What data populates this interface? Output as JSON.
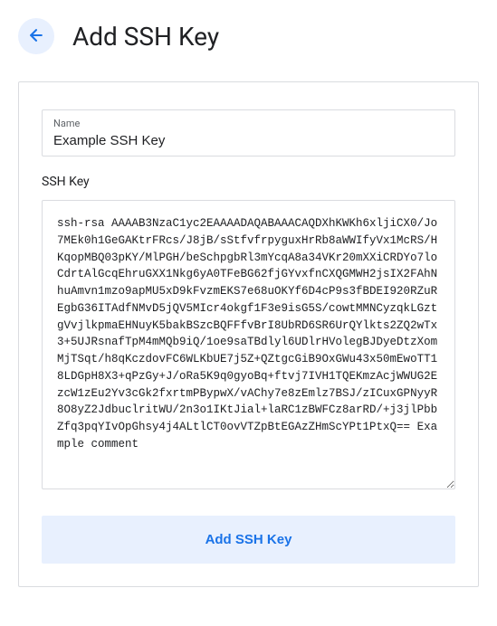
{
  "header": {
    "title": "Add SSH Key"
  },
  "form": {
    "name_label": "Name",
    "name_value": "Example SSH Key",
    "ssh_label": "SSH Key",
    "ssh_value": "ssh-rsa AAAAB3NzaC1yc2EAAAADAQABAAACAQDXhKWKh6xljiCX0/Jo7MEk0h1GeGAKtrFRcs/J8jB/sStfvfrpyguxHrRb8aWWIfyVx1McRS/HKqopMBQ03pKY/MlPGH/beSchpgbRl3mYcqA8a34VKr20mXXiCRDYo7loCdrtAlGcqEhruGXX1Nkg6yA0TFeBG62fjGYvxfnCXQGMWH2jsIX2FAhNhuAmvn1mzo9apMU5xD9kFvzmEKS7e68uOKYf6D4cP9s3fBDEI920RZuREgbG36ITAdfNMvD5jQV5MIcr4okgf1F3e9isG5S/cowtMMNCyzqkLGztgVvjlkpmaEHNuyK5bakBSzcBQFFfvBrI8UbRD6SR6UrQYlkts2ZQ2wTx3+5UJRsnafTpM4mMQb9iQ/1oe9saTBdlyl6UDlrHVolegBJDyeDtzXomMjTSqt/h8qKczdovFC6WLKbUE7j5Z+QZtgcGiB9OxGWu43x50mEwoTT18LDGpH8X3+qPzGy+J/oRa5K9q0gyoBq+ftvj7IVH1TQEKmzAcjWWUG2EzcW1zEu2Yv3cGk2fxrtmPBypwX/vAChy7e8zEmlz7BSJ/zICuxGPNyyR8O8yZ2JdbuclritWU/2n3o1IKtJial+laRC1zBWFCz8arRD/+j3jlPbbZfq3pqYIvOpGhsy4j4ALtlCT0ovVTZpBtEGAzZHmScYPt1PtxQ== Example comment",
    "submit_label": "Add SSH Key"
  }
}
